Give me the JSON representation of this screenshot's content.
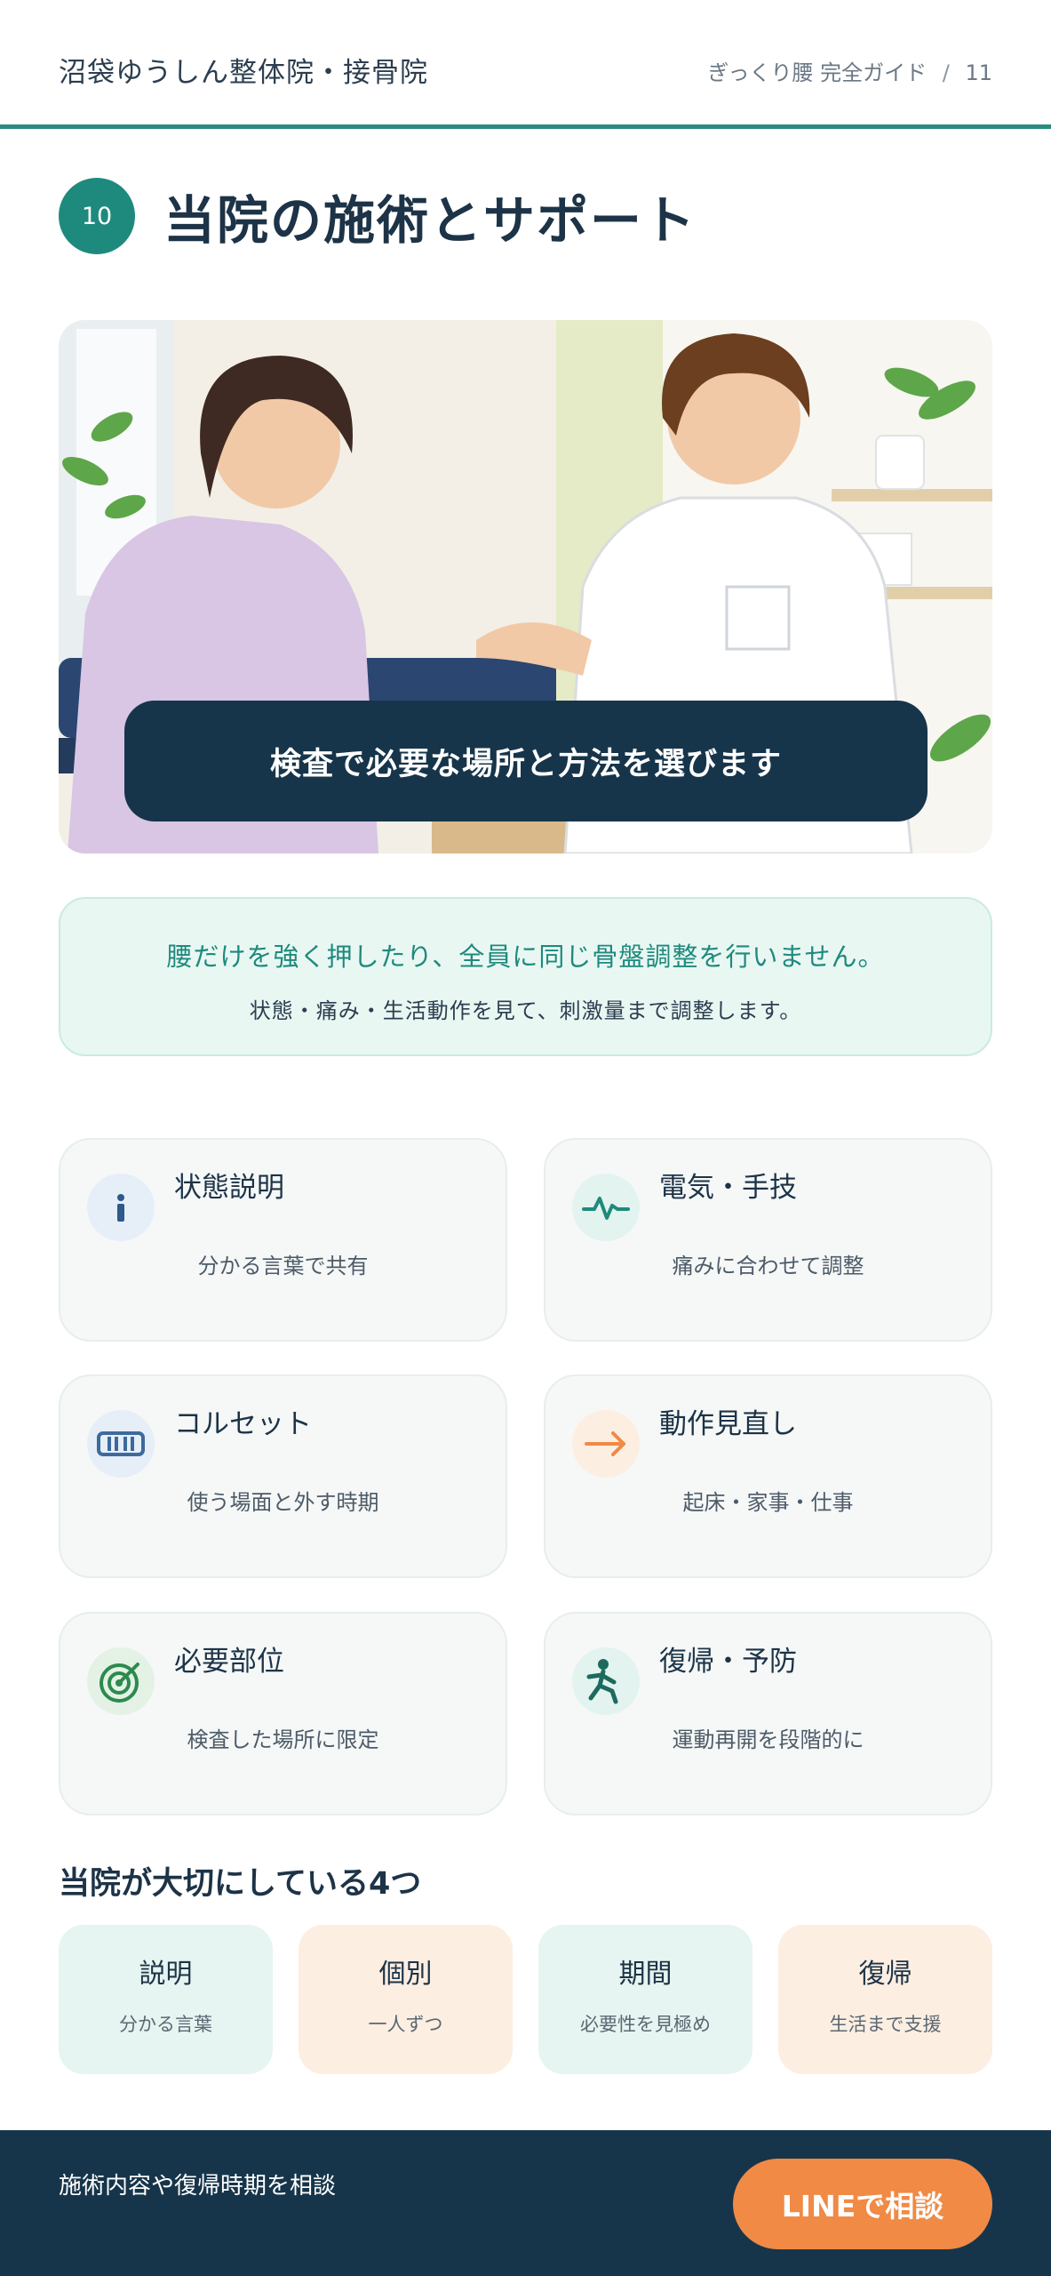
{
  "header": {
    "clinic_name": "沼袋ゆうしん整体院・接骨院",
    "guide_title": "ぎっくり腰 完全ガイド",
    "separator": "/",
    "page_number": "11"
  },
  "section": {
    "number": "10",
    "title": "当院の施術とサポート"
  },
  "hero": {
    "caption": "検査で必要な場所と方法を選びます"
  },
  "note": {
    "main": "腰だけを強く押したり、全員に同じ骨盤調整を行いません。",
    "sub": "状態・痛み・生活動作を見て、刺激量まで調整します。"
  },
  "services": [
    {
      "icon": "info-icon",
      "title": "状態説明",
      "desc": "分かる言葉で共有",
      "color": "#2c5a8a"
    },
    {
      "icon": "pulse-icon",
      "title": "電気・手技",
      "desc": "痛みに合わせて調整",
      "color": "#1e8a7d"
    },
    {
      "icon": "corset-icon",
      "title": "コルセット",
      "desc": "使う場面と外す時期",
      "color": "#3d6a9c"
    },
    {
      "icon": "arrow-right-icon",
      "title": "動作見直し",
      "desc": "起床・家事・仕事",
      "color": "#f08a45"
    },
    {
      "icon": "target-icon",
      "title": "必要部位",
      "desc": "検査した場所に限定",
      "color": "#2d8a4e"
    },
    {
      "icon": "running-icon",
      "title": "復帰・予防",
      "desc": "運動再開を段階的に",
      "color": "#1e6a5e"
    }
  ],
  "values": {
    "title": "当院が大切にしている4つ",
    "items": [
      {
        "title": "説明",
        "desc": "分かる言葉"
      },
      {
        "title": "個別",
        "desc": "一人ずつ"
      },
      {
        "title": "期間",
        "desc": "必要性を見極め"
      },
      {
        "title": "復帰",
        "desc": "生活まで支援"
      }
    ]
  },
  "bottom": {
    "text": "施術内容や復帰時期を相談",
    "cta": "LINEで相談"
  },
  "colors": {
    "accent": "#1e8a7d",
    "navy": "#17354a",
    "orange": "#f08a45"
  }
}
